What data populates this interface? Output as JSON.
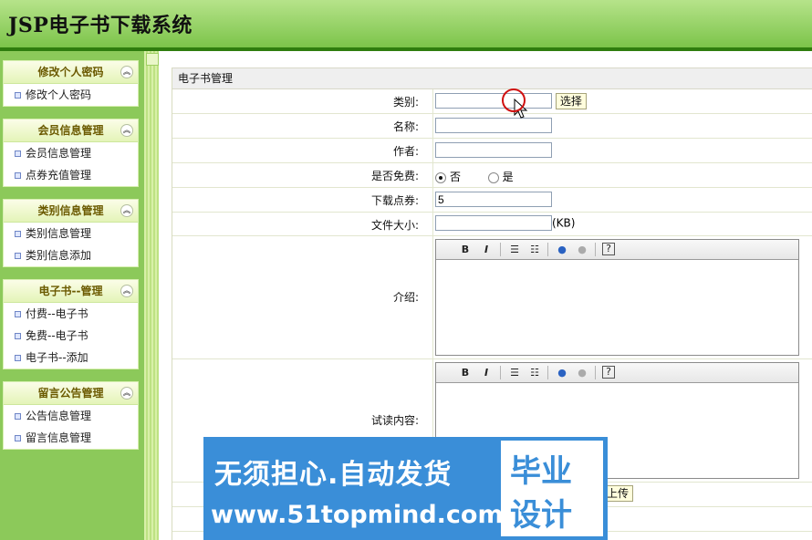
{
  "app_title": "JSP电子书下载系统",
  "sidebar": {
    "groups": [
      {
        "title": "修改个人密码",
        "items": [
          "修改个人密码"
        ]
      },
      {
        "title": "会员信息管理",
        "items": [
          "会员信息管理",
          "点券充值管理"
        ]
      },
      {
        "title": "类别信息管理",
        "items": [
          "类别信息管理",
          "类别信息添加"
        ]
      },
      {
        "title": "电子书--管理",
        "items": [
          "付费--电子书",
          "免费--电子书",
          "电子书--添加"
        ]
      },
      {
        "title": "留言公告管理",
        "items": [
          "公告信息管理",
          "留言信息管理"
        ]
      }
    ]
  },
  "main": {
    "section_title": "电子书管理",
    "fields": {
      "category_label": "类别:",
      "category_value": "",
      "choose_button": "选择",
      "name_label": "名称:",
      "name_value": "",
      "author_label": "作者:",
      "author_value": "",
      "free_label": "是否免费:",
      "free_options": [
        "否",
        "是"
      ],
      "free_selected": "否",
      "points_label": "下载点券:",
      "points_value": "5",
      "size_label": "文件大小:",
      "size_value": "",
      "size_unit": "(KB)",
      "intro_label": "介绍:",
      "trial_label": "试读内容:",
      "upload_button": "上传"
    },
    "editor_toolbar": [
      "B",
      "I",
      "numbered-list-icon",
      "bullet-list-icon",
      "link-icon",
      "unlink-icon",
      "help-icon"
    ]
  },
  "watermark": {
    "line1": "无须担心.自动发货",
    "line2": "www.51topmind.com",
    "box_line1": "毕业",
    "box_line2": "设计"
  },
  "colors": {
    "header_green": "#7cc44a",
    "sidebar_green": "#8cc95a",
    "watermark_blue": "#3a8ed8"
  }
}
